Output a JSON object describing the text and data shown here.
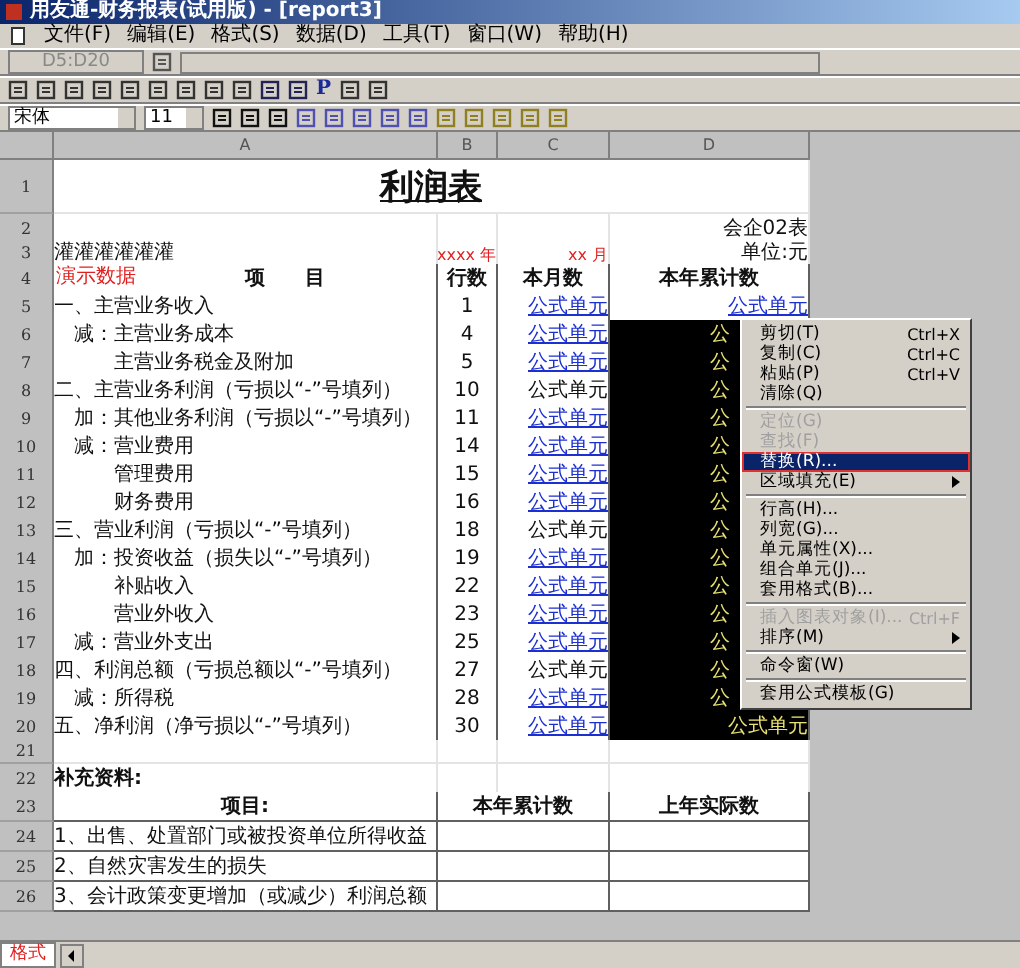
{
  "window": {
    "title": "用友通-财务报表(试用版) - [report3]"
  },
  "menu": [
    "文件(F)",
    "编辑(E)",
    "格式(S)",
    "数据(D)",
    "工具(T)",
    "窗口(W)",
    "帮助(H)"
  ],
  "formula_bar": {
    "cell_ref": "D5:D20"
  },
  "format_bar": {
    "font": "宋体",
    "size": "11",
    "toolbar_letter": "P"
  },
  "sheet": {
    "columns": [
      "A",
      "B",
      "C",
      "D"
    ],
    "title_row": {
      "num": "1",
      "text": "利润表"
    },
    "note_row": {
      "num": "2",
      "text": "会企02表"
    },
    "unit_row": {
      "num": "3",
      "a": "灌灌灌灌灌灌",
      "year": "xxxx 年",
      "month": "xx 月",
      "d": "单位:元"
    },
    "header_row": {
      "num": "4",
      "tag": "演示数据",
      "a": "项　　目",
      "b": "行数",
      "c": "本月数",
      "d": "本年累计数"
    },
    "rows": [
      {
        "num": "5",
        "a": "一、主营业务收入",
        "b": "1",
        "c": "公式单元",
        "c_linked": true,
        "d": "公式单元",
        "d_selected": false
      },
      {
        "num": "6",
        "a": "　减：主营业务成本",
        "b": "4",
        "c": "公式单元",
        "c_linked": true,
        "d": "公",
        "d_selected": true
      },
      {
        "num": "7",
        "a": "　　　主营业务税金及附加",
        "b": "5",
        "c": "公式单元",
        "c_linked": true,
        "d": "公",
        "d_selected": true
      },
      {
        "num": "8",
        "a": "二、主营业务利润（亏损以“-”号填列）",
        "b": "10",
        "c": "公式单元",
        "c_linked": false,
        "d": "公",
        "d_selected": true
      },
      {
        "num": "9",
        "a": "　加：其他业务利润（亏损以“-”号填列）",
        "b": "11",
        "c": "公式单元",
        "c_linked": true,
        "d": "公",
        "d_selected": true
      },
      {
        "num": "10",
        "a": "　减：营业费用",
        "b": "14",
        "c": "公式单元",
        "c_linked": true,
        "d": "公",
        "d_selected": true
      },
      {
        "num": "11",
        "a": "　　　管理费用",
        "b": "15",
        "c": "公式单元",
        "c_linked": true,
        "d": "公",
        "d_selected": true
      },
      {
        "num": "12",
        "a": "　　　财务费用",
        "b": "16",
        "c": "公式单元",
        "c_linked": true,
        "d": "公",
        "d_selected": true
      },
      {
        "num": "13",
        "a": "三、营业利润（亏损以“-”号填列）",
        "b": "18",
        "c": "公式单元",
        "c_linked": false,
        "d": "公",
        "d_selected": true
      },
      {
        "num": "14",
        "a": "　加：投资收益（损失以“-”号填列）",
        "b": "19",
        "c": "公式单元",
        "c_linked": true,
        "d": "公",
        "d_selected": true
      },
      {
        "num": "15",
        "a": "　　　补贴收入",
        "b": "22",
        "c": "公式单元",
        "c_linked": true,
        "d": "公",
        "d_selected": true
      },
      {
        "num": "16",
        "a": "　　　营业外收入",
        "b": "23",
        "c": "公式单元",
        "c_linked": true,
        "d": "公",
        "d_selected": true
      },
      {
        "num": "17",
        "a": "　减：营业外支出",
        "b": "25",
        "c": "公式单元",
        "c_linked": true,
        "d": "公",
        "d_selected": true
      },
      {
        "num": "18",
        "a": "四、利润总额（亏损总额以“-”号填列）",
        "b": "27",
        "c": "公式单元",
        "c_linked": false,
        "d": "公",
        "d_selected": true
      },
      {
        "num": "19",
        "a": "　减：所得税",
        "b": "28",
        "c": "公式单元",
        "c_linked": true,
        "d": "公",
        "d_selected": true
      },
      {
        "num": "20",
        "a": "五、净利润（净亏损以“-”号填列）",
        "b": "30",
        "c": "公式单元",
        "c_linked": true,
        "d": "公式单元",
        "d_selected": true
      }
    ],
    "blank_row": {
      "num": "21"
    },
    "supplement_row": {
      "num": "22",
      "text": "补充资料:"
    },
    "supplement_header": {
      "num": "23",
      "a": "项目:",
      "bc": "本年累计数",
      "d": "上年实际数"
    },
    "supplement_rows": [
      {
        "num": "24",
        "a": "1、出售、处置部门或被投资单位所得收益"
      },
      {
        "num": "25",
        "a": "2、自然灾害发生的损失"
      },
      {
        "num": "26",
        "a": "3、会计政策变更增加（或减少）利润总额"
      }
    ]
  },
  "context_menu": [
    {
      "kind": "item",
      "label": "剪切(T)",
      "shortcut": "Ctrl+X",
      "disabled": false,
      "selected": false,
      "submenu": false
    },
    {
      "kind": "item",
      "label": "复制(C)",
      "shortcut": "Ctrl+C",
      "disabled": false,
      "selected": false,
      "submenu": false
    },
    {
      "kind": "item",
      "label": "粘贴(P)",
      "shortcut": "Ctrl+V",
      "disabled": false,
      "selected": false,
      "submenu": false
    },
    {
      "kind": "item",
      "label": "清除(Q)",
      "disabled": false,
      "selected": false,
      "submenu": false
    },
    {
      "kind": "separator"
    },
    {
      "kind": "item",
      "label": "定位(G)",
      "disabled": true,
      "selected": false,
      "submenu": false
    },
    {
      "kind": "item",
      "label": "查找(F)",
      "disabled": true,
      "selected": false,
      "submenu": false
    },
    {
      "kind": "item",
      "label": "替换(R)...",
      "disabled": false,
      "selected": true,
      "submenu": false
    },
    {
      "kind": "item",
      "label": "区域填充(E)",
      "disabled": false,
      "selected": false,
      "submenu": true
    },
    {
      "kind": "separator"
    },
    {
      "kind": "item",
      "label": "行高(H)...",
      "disabled": false,
      "selected": false,
      "submenu": false
    },
    {
      "kind": "item",
      "label": "列宽(G)...",
      "disabled": false,
      "selected": false,
      "submenu": false
    },
    {
      "kind": "item",
      "label": "单元属性(X)...",
      "disabled": false,
      "selected": false,
      "submenu": false
    },
    {
      "kind": "item",
      "label": "组合单元(J)...",
      "disabled": false,
      "selected": false,
      "submenu": false
    },
    {
      "kind": "item",
      "label": "套用格式(B)...",
      "disabled": false,
      "selected": false,
      "submenu": false
    },
    {
      "kind": "separator"
    },
    {
      "kind": "item",
      "label": "插入图表对象(I)...",
      "shortcut": "Ctrl+F",
      "disabled": true,
      "selected": false,
      "submenu": false
    },
    {
      "kind": "item",
      "label": "排序(M)",
      "disabled": false,
      "selected": false,
      "submenu": true
    },
    {
      "kind": "separator"
    },
    {
      "kind": "item",
      "label": "命令窗(W)",
      "disabled": false,
      "selected": false,
      "submenu": false
    },
    {
      "kind": "separator"
    },
    {
      "kind": "item",
      "label": "套用公式模板(G)",
      "disabled": false,
      "selected": false,
      "submenu": false
    }
  ],
  "sheet_tabs": [
    {
      "label": "格式",
      "selected": true
    }
  ]
}
